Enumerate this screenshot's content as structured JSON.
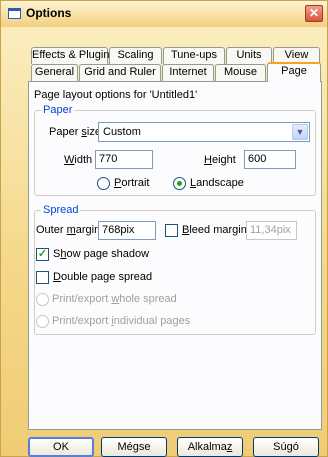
{
  "window": {
    "title": "Options",
    "close_glyph": "✕"
  },
  "tabs_row1": [
    "Effects & Plugins",
    "Scaling",
    "Tune-ups",
    "Units",
    "View"
  ],
  "tabs_row2": [
    "General",
    "Grid and Ruler",
    "Internet",
    "Mouse",
    "Page"
  ],
  "active_tab": "Page",
  "page": {
    "heading": "Page layout options for 'Untitled1'",
    "paper": {
      "group_label": "Paper",
      "size_label": "Paper size",
      "size_value": "Custom",
      "width_label": "Width",
      "width_value": "770",
      "height_label": "Height",
      "height_value": "600",
      "portrait_label": "Portrait",
      "landscape_label": "Landscape",
      "orientation": "Landscape"
    },
    "spread": {
      "group_label": "Spread",
      "outer_margin_label": "Outer margin",
      "outer_margin_value": "768pix",
      "bleed_margin_label": "Bleed margin",
      "bleed_margin_value": "11,34pix",
      "bleed_checked": false,
      "show_shadow_label": "Show page shadow",
      "show_shadow_checked": true,
      "double_spread_label": "Double page spread",
      "double_spread_checked": false,
      "print_whole_label": "Print/export whole spread",
      "print_individual_label": "Print/export individual pages"
    }
  },
  "buttons": {
    "ok": "OK",
    "cancel": "Mégse",
    "apply": "Alkalmaz",
    "help": "Súgó"
  },
  "icons": {
    "dropdown": "chevron-down-icon",
    "close": "close-icon"
  },
  "colors": {
    "active_tab_accent": "#f6a31f",
    "group_title": "#0046d5",
    "close_button": "#d9533b"
  }
}
